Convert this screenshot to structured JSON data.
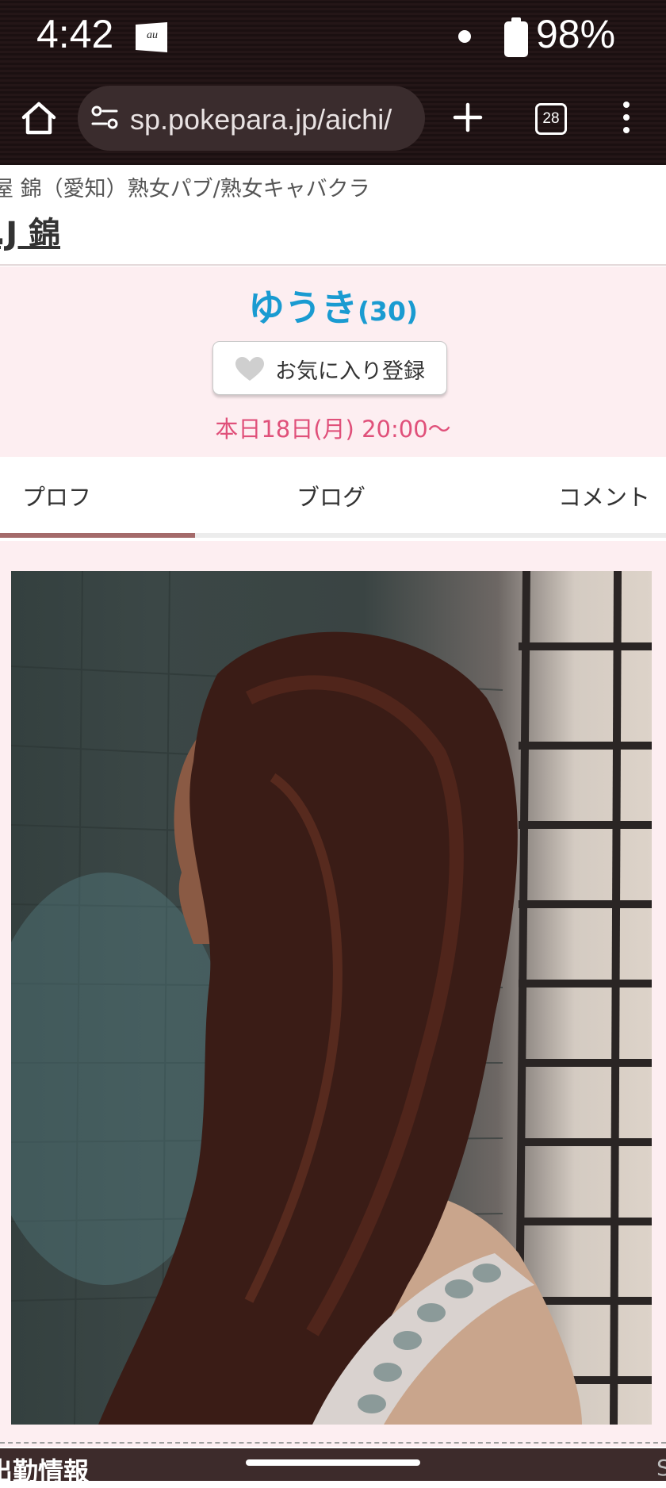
{
  "status_bar": {
    "time": "4:42",
    "carrier_badge": "au",
    "battery": "98%",
    "battery_level": 0.98,
    "icons": [
      "carrier-au-icon",
      "notification-dot-icon",
      "battery-icon"
    ]
  },
  "browser": {
    "url": "sp.pokepara.jp/aichi/",
    "tab_count": "28",
    "icons": [
      "home-icon",
      "site-settings-icon",
      "new-tab-plus-icon",
      "tab-switcher-icon",
      "more-vert-icon"
    ]
  },
  "shop": {
    "meta": "屋 錦（愛知）熟女パブ/熟女キャバクラ",
    "name": ".J 錦"
  },
  "profile": {
    "name": "ゆうき",
    "age": "(30)",
    "favorite_button": "お気に入り登録",
    "schedule": "本日18日(月) 20:00〜"
  },
  "tabs": [
    {
      "label": "プロフ",
      "active": true
    },
    {
      "label": "ブログ",
      "active": false
    },
    {
      "label": "コメント",
      "active": false
    }
  ],
  "photo": {
    "subject": "long-haired woman in profile",
    "icon": "profile-photo"
  },
  "section": {
    "title": "出勤情報",
    "right_text": "S"
  },
  "colors": {
    "name_blue": "#1a9bd1",
    "schedule_pink": "#e0507a",
    "header_pink_bg": "#fdeef1",
    "tab_indicator": "#a46a6a",
    "chrome_bg": "#1b1011",
    "section_bar": "#3d2b2b"
  }
}
